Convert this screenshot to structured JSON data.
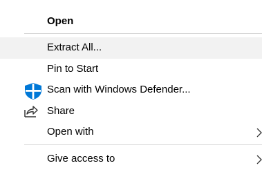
{
  "context_menu": {
    "items": [
      {
        "label": "Open",
        "icon": ""
      },
      {
        "label": "Extract All...",
        "icon": ""
      },
      {
        "label": "Pin to Start",
        "icon": ""
      },
      {
        "label": "Scan with Windows Defender...",
        "icon": "windows-defender-shield-icon"
      },
      {
        "label": "Share",
        "icon": "share-icon"
      },
      {
        "label": "Open with",
        "icon": "",
        "submenu": true
      },
      {
        "label": "Give access to",
        "icon": "",
        "submenu": true
      }
    ],
    "accent_color": "#0078d7"
  }
}
